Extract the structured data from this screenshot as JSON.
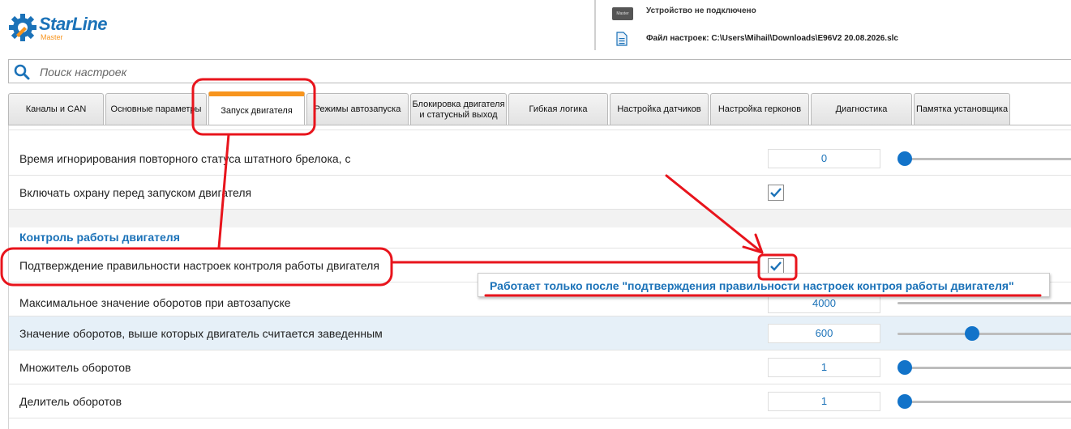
{
  "app": {
    "logo_text": "StarLine",
    "logo_sub": "Master",
    "device_icon_text": "Master",
    "device_status": "Устройство не подключено",
    "settings_file": "Файл настроек: C:\\Users\\Mihail\\Downloads\\E96V2 20.08.2026.slc"
  },
  "search": {
    "placeholder": "Поиск настроек"
  },
  "tabs": [
    {
      "label": "Каналы и CAN"
    },
    {
      "label": "Основные параметры"
    },
    {
      "label": "Запуск двигателя"
    },
    {
      "label": "Режимы автозапуска"
    },
    {
      "label": "Блокировка двигателя и статусный выход"
    },
    {
      "label": "Гибкая логика"
    },
    {
      "label": "Настройка датчиков"
    },
    {
      "label": "Настройка герконов"
    },
    {
      "label": "Диагностика"
    },
    {
      "label": "Памятка установщика"
    }
  ],
  "settings": {
    "rows": [
      {
        "label": "Время игнорирования повторного статуса штатного брелока, с",
        "value": "0",
        "slider_fraction": 0.0
      },
      {
        "label": "Включать охрану перед запуском двигателя",
        "checked": true
      },
      {
        "label": "Подтверждение правильности настроек контроля работы двигателя",
        "checked": true
      },
      {
        "label": "Максимальное значение оборотов при автозапуске",
        "value": "4000"
      },
      {
        "label": "Значение оборотов, выше которых двигатель считается заведенным",
        "value": "600",
        "slider_fraction": 0.42
      },
      {
        "label": "Множитель оборотов",
        "value": "1",
        "slider_fraction": 0.0
      },
      {
        "label": "Делитель оборотов",
        "value": "1",
        "slider_fraction": 0.0
      }
    ],
    "section_title": "Контроль работы двигателя"
  },
  "tooltip": {
    "text": "Работает только после \"подтверждения правильности настроек контроя работы двигателя\""
  },
  "colors": {
    "accent": "#1b72b8",
    "tab_active": "#f7941d",
    "annotation": "#e8141c",
    "row_highlight": "#e6f0f8"
  }
}
